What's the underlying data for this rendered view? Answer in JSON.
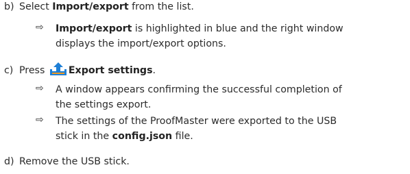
{
  "steps": {
    "b": {
      "letter": "b)",
      "pre": "Select ",
      "bold": "Import/export",
      "post": " from the list.",
      "results": [
        {
          "arrow": "⇨",
          "bold": "Import/export",
          "text_line1": " is highlighted in blue and the right window",
          "text_line2": "displays the import/export options."
        }
      ]
    },
    "c": {
      "letter": "c)",
      "pre": "Press ",
      "icon": "export-upload-icon",
      "bold": "Export settings",
      "post": ".",
      "results": [
        {
          "arrow": "⇨",
          "text_line1": "A window appears confirming the successful completion of",
          "text_line2": "the settings export."
        },
        {
          "arrow": "⇨",
          "text_line1": "The settings of the ProofMaster were exported to the USB",
          "text_line2_pre": "stick in the ",
          "text_line2_bold": "config.json",
          "text_line2_post": " file."
        }
      ]
    },
    "d": {
      "letter": "d)",
      "text": "Remove the USB stick."
    }
  },
  "colors": {
    "text": "#2b2b2b",
    "icon_blue": "#1e7fd6",
    "icon_orange": "#f39a1f"
  }
}
